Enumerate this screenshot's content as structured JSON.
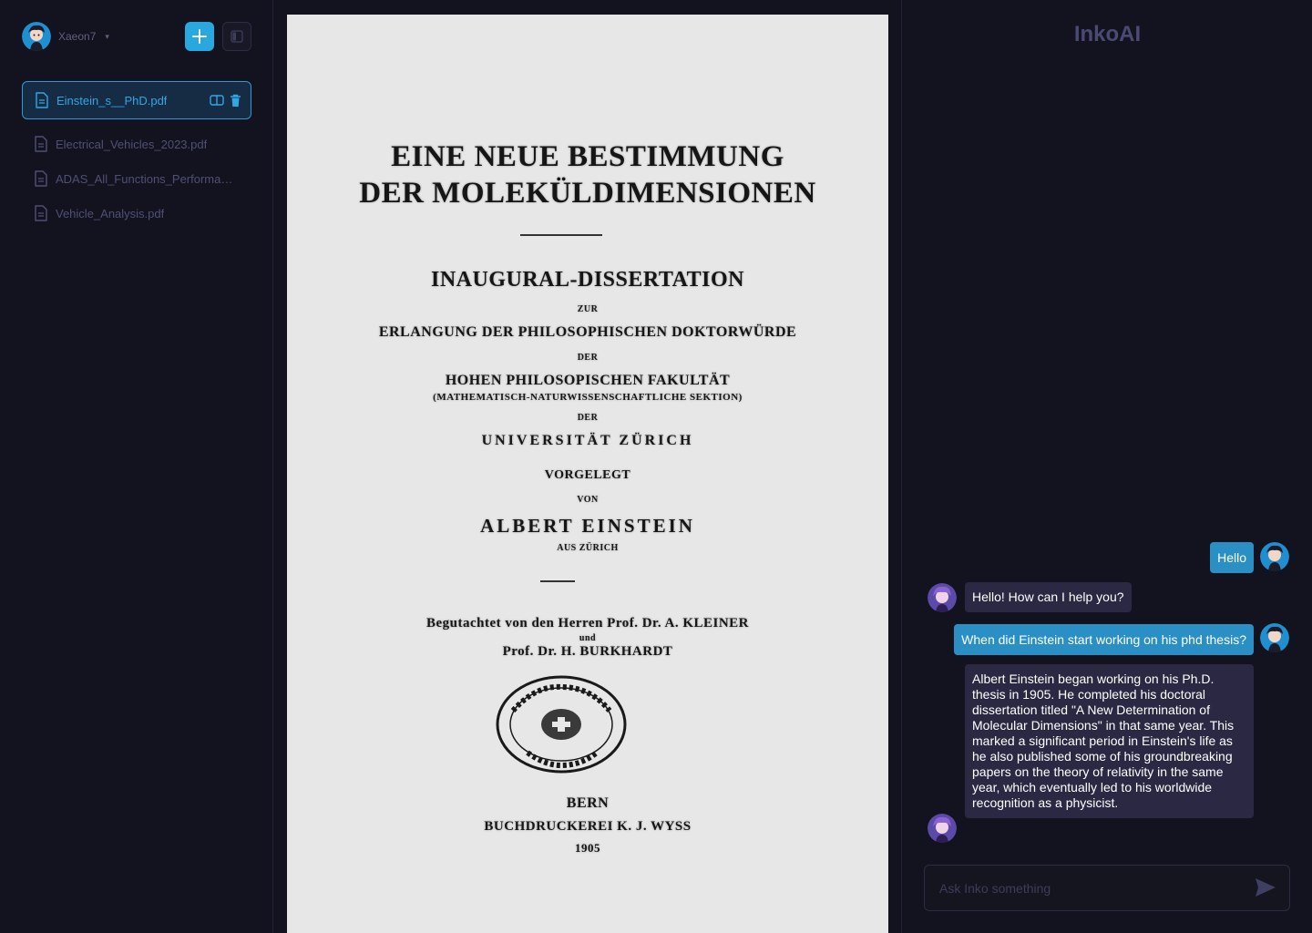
{
  "user": {
    "name": "Xaeon7"
  },
  "sidebar": {
    "files": [
      {
        "label": "Einstein_s__PhD.pdf",
        "active": true
      },
      {
        "label": "Electrical_Vehicles_2023.pdf"
      },
      {
        "label": "ADAS_All_Functions_Performam..."
      },
      {
        "label": "Vehicle_Analysis.pdf"
      }
    ]
  },
  "document": {
    "title_line1": "EINE NEUE BESTIMMUNG",
    "title_line2": "DER MOLEKÜLDIMENSIONEN",
    "subtitle": "INAUGURAL-DISSERTATION",
    "zur": "ZUR",
    "erlangung": "ERLANGUNG DER PHILOSOPHISCHEN DOKTORWÜRDE",
    "der1": "DER",
    "fakultaet": "HOHEN PHILOSOPISCHEN FAKULTÄT",
    "section": "(MATHEMATISCH-NATURWISSENSCHAFTLICHE SEKTION)",
    "der2": "DER",
    "university": "UNIVERSITÄT ZÜRICH",
    "vorgelegt": "VORGELEGT",
    "von": "VON",
    "author": "ALBERT EINSTEIN",
    "aus": "AUS ZÜRICH",
    "reviewers_line1": "Begutachtet von den Herren Prof. Dr. A. KLEINER",
    "und": "und",
    "reviewers_line2": "Prof. Dr. H. BURKHARDT",
    "seal_text": "EIDGEN. POLYTECHN. SCHULE · BIBLIOTHEK",
    "city": "BERN",
    "printer": "BUCHDRUCKEREI K. J. WYSS",
    "year": "1905"
  },
  "chat": {
    "brand": "InkoAI",
    "messages": [
      {
        "role": "user",
        "text": "Hello"
      },
      {
        "role": "bot",
        "text": "Hello! How can I help you?"
      },
      {
        "role": "user",
        "text": "When did Einstein start working on his phd thesis?"
      },
      {
        "role": "bot",
        "text": "Albert Einstein began working on his Ph.D. thesis in 1905. He completed his doctoral dissertation titled \"A New Determination of Molecular Dimensions\" in that same year. This marked a significant period in Einstein's life as he also published some of his groundbreaking papers on the theory of relativity in the same year, which eventually led to his worldwide recognition as a physicist."
      }
    ],
    "input_placeholder": "Ask Inko something"
  },
  "colors": {
    "accent": "#29a8e0",
    "user_bubble": "#2a8fc4",
    "bot_bubble": "#2a2842",
    "brand": "#4a4a72"
  },
  "icons": [
    "plus-icon",
    "panel-toggle-icon",
    "file-icon",
    "split-view-icon",
    "trash-icon",
    "chevron-down-icon",
    "send-icon"
  ]
}
